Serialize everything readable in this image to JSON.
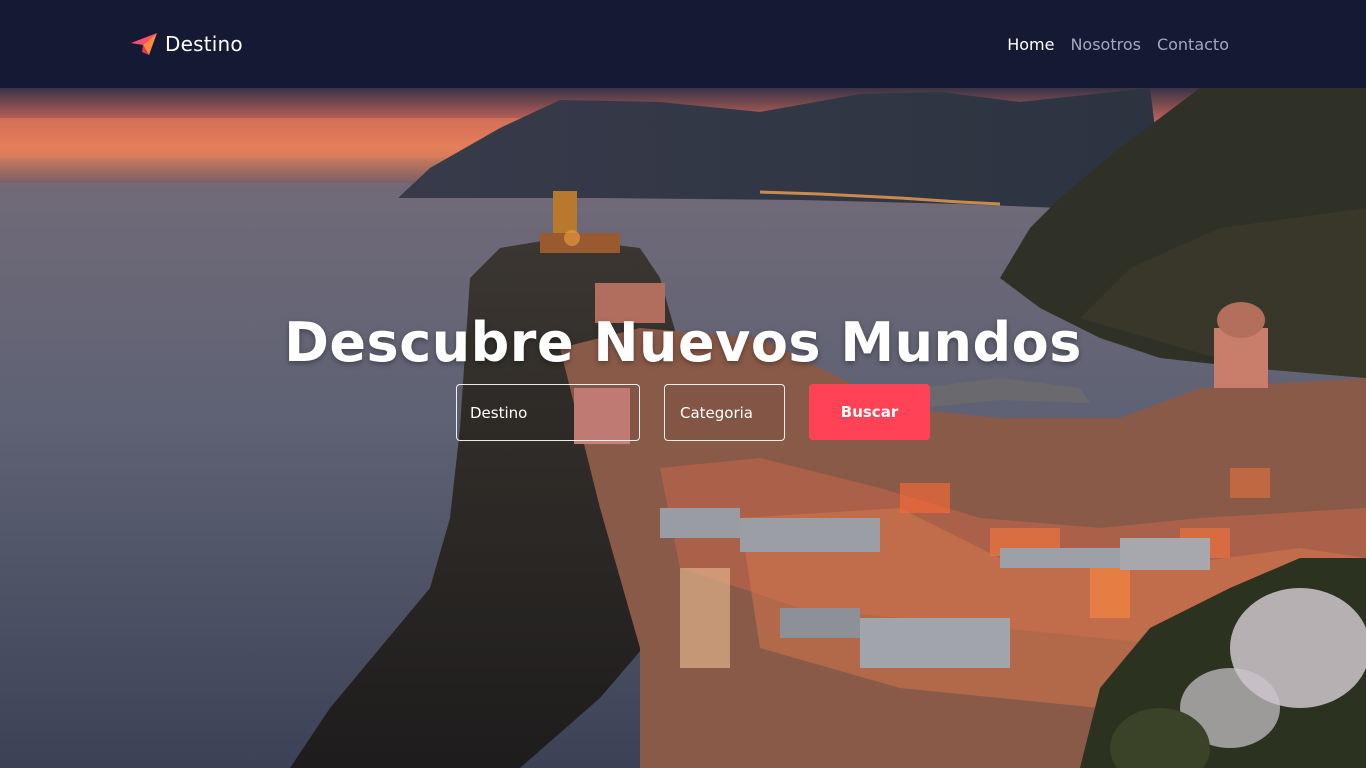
{
  "brand": {
    "name": "Destino",
    "icon": "paper-plane-icon",
    "accent": "#ff4255"
  },
  "nav": {
    "items": [
      {
        "label": "Home",
        "active": true
      },
      {
        "label": "Nosotros",
        "active": false
      },
      {
        "label": "Contacto",
        "active": false
      }
    ]
  },
  "hero": {
    "title": "Descubre Nuevos Mundos",
    "destination_field": "Destino",
    "category_field": "Categoria",
    "search_button": "Buscar"
  },
  "colors": {
    "navbar": "#141a33",
    "button": "#ff4255"
  }
}
